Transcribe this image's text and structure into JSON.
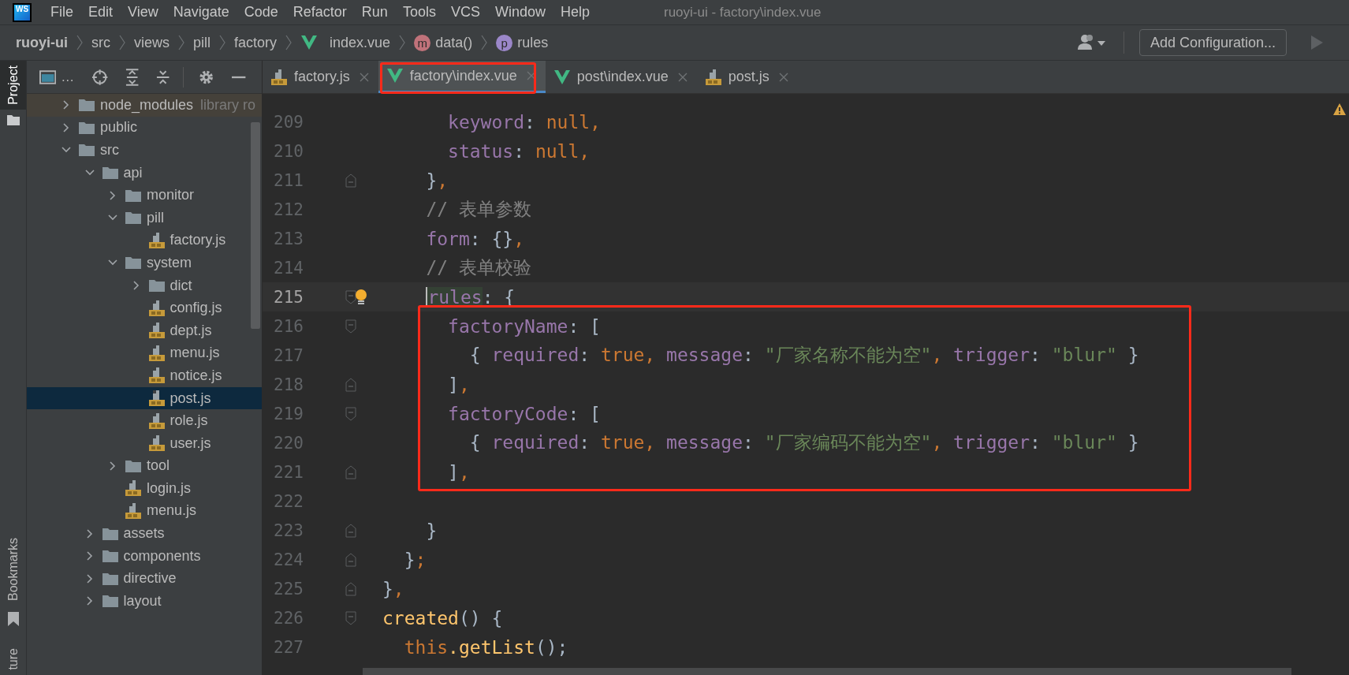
{
  "menu_bar": {
    "logo_text": "WS",
    "items": [
      "File",
      "Edit",
      "View",
      "Navigate",
      "Code",
      "Refactor",
      "Run",
      "Tools",
      "VCS",
      "Window",
      "Help"
    ],
    "title": "ruoyi-ui - factory\\index.vue"
  },
  "breadcrumb": {
    "items": [
      {
        "label": "ruoyi-ui",
        "kind": "project"
      },
      {
        "label": "src",
        "kind": "folder"
      },
      {
        "label": "views",
        "kind": "folder"
      },
      {
        "label": "pill",
        "kind": "folder"
      },
      {
        "label": "factory",
        "kind": "folder"
      },
      {
        "label": "index.vue",
        "kind": "vue"
      },
      {
        "label": "data()",
        "kind": "method",
        "badge": "m"
      },
      {
        "label": "rules",
        "kind": "property",
        "badge": "p"
      }
    ],
    "config_button": "Add Configuration..."
  },
  "tool_strip": {
    "top": [
      {
        "label": "Project",
        "selected": true
      }
    ],
    "bottom": [
      {
        "label": "Bookmarks",
        "selected": false
      },
      {
        "label": "ture",
        "selected": false
      }
    ]
  },
  "project": {
    "title": "…",
    "tree": [
      {
        "name": "node_modules",
        "kind": "folder",
        "expanded": false,
        "selected": false,
        "hint": "library ro"
      },
      {
        "name": "public",
        "kind": "folder",
        "expanded": false,
        "selected": false
      },
      {
        "name": "src",
        "kind": "folder",
        "expanded": true,
        "selected": false,
        "children": [
          {
            "name": "api",
            "kind": "folder",
            "expanded": true,
            "selected": false,
            "children": [
              {
                "name": "monitor",
                "kind": "folder",
                "expanded": false,
                "selected": false
              },
              {
                "name": "pill",
                "kind": "folder",
                "expanded": true,
                "selected": false,
                "children": [
                  {
                    "name": "factory.js",
                    "kind": "js",
                    "selected": false
                  }
                ]
              },
              {
                "name": "system",
                "kind": "folder",
                "expanded": true,
                "selected": false,
                "children": [
                  {
                    "name": "dict",
                    "kind": "folder",
                    "expanded": false,
                    "selected": false
                  },
                  {
                    "name": "config.js",
                    "kind": "js",
                    "selected": false
                  },
                  {
                    "name": "dept.js",
                    "kind": "js",
                    "selected": false
                  },
                  {
                    "name": "menu.js",
                    "kind": "js",
                    "selected": false
                  },
                  {
                    "name": "notice.js",
                    "kind": "js",
                    "selected": false
                  },
                  {
                    "name": "post.js",
                    "kind": "js",
                    "selected": true
                  },
                  {
                    "name": "role.js",
                    "kind": "js",
                    "selected": false
                  },
                  {
                    "name": "user.js",
                    "kind": "js",
                    "selected": false
                  }
                ]
              },
              {
                "name": "tool",
                "kind": "folder",
                "expanded": false,
                "selected": false
              },
              {
                "name": "login.js",
                "kind": "js",
                "selected": false
              },
              {
                "name": "menu.js",
                "kind": "js",
                "selected": false
              }
            ]
          },
          {
            "name": "assets",
            "kind": "folder",
            "expanded": false,
            "selected": false
          },
          {
            "name": "components",
            "kind": "folder",
            "expanded": false,
            "selected": false
          },
          {
            "name": "directive",
            "kind": "folder",
            "expanded": false,
            "selected": false
          },
          {
            "name": "layout",
            "kind": "folder",
            "expanded": false,
            "selected": false
          }
        ]
      }
    ]
  },
  "tabs": [
    {
      "label": "factory.js",
      "kind": "js",
      "selected": false,
      "framed": false
    },
    {
      "label": "factory\\index.vue",
      "kind": "vue",
      "selected": true,
      "framed": true
    },
    {
      "label": "post\\index.vue",
      "kind": "vue",
      "selected": false,
      "framed": false
    },
    {
      "label": "post.js",
      "kind": "js",
      "selected": false,
      "framed": false
    }
  ],
  "editor": {
    "warning": true,
    "blocks": [
      {
        "framed": false,
        "lines": [
          {
            "number": "209",
            "current": false,
            "bulb": false,
            "fold_open": false,
            "fold_close": false,
            "tokens": [
              {
                "text": "      keyword",
                "kind": "prop"
              },
              {
                "text": ": ",
                "kind": "punct"
              },
              {
                "text": "null",
                "kind": "kw"
              },
              {
                "text": ",",
                "kind": "kw"
              }
            ]
          },
          {
            "number": "210",
            "current": false,
            "bulb": false,
            "fold_open": false,
            "fold_close": false,
            "tokens": [
              {
                "text": "      status",
                "kind": "prop"
              },
              {
                "text": ": ",
                "kind": "punct"
              },
              {
                "text": "null",
                "kind": "kw"
              },
              {
                "text": ",",
                "kind": "kw"
              }
            ]
          },
          {
            "number": "211",
            "current": false,
            "bulb": false,
            "fold_open": false,
            "fold_close": true,
            "tokens": [
              {
                "text": "    }",
                "kind": "punct"
              },
              {
                "text": ",",
                "kind": "kw"
              }
            ]
          },
          {
            "number": "212",
            "current": false,
            "bulb": false,
            "fold_open": false,
            "fold_close": false,
            "tokens": [
              {
                "text": "    // 表单参数",
                "kind": "comment"
              }
            ]
          },
          {
            "number": "213",
            "current": false,
            "bulb": false,
            "fold_open": false,
            "fold_close": false,
            "tokens": [
              {
                "text": "    form",
                "kind": "prop"
              },
              {
                "text": ": {}",
                "kind": "punct"
              },
              {
                "text": ",",
                "kind": "kw"
              }
            ]
          },
          {
            "number": "214",
            "current": false,
            "bulb": false,
            "fold_open": false,
            "fold_close": false,
            "tokens": [
              {
                "text": "    // 表单校验",
                "kind": "comment"
              }
            ]
          },
          {
            "number": "215",
            "current": true,
            "bulb": true,
            "fold_open": true,
            "fold_close": false,
            "tokens": [
              {
                "text": "    rules",
                "kind": "prop",
                "match": true
              },
              {
                "text": ": {",
                "kind": "punct"
              }
            ]
          }
        ]
      },
      {
        "framed": true,
        "lines": [
          {
            "number": "216",
            "current": false,
            "bulb": false,
            "fold_open": true,
            "fold_close": false,
            "tokens": [
              {
                "text": "      factoryName",
                "kind": "prop"
              },
              {
                "text": ": [",
                "kind": "punct"
              }
            ]
          },
          {
            "number": "217",
            "current": false,
            "bulb": false,
            "fold_open": false,
            "fold_close": false,
            "tokens": [
              {
                "text": "        { ",
                "kind": "punct"
              },
              {
                "text": "required",
                "kind": "prop"
              },
              {
                "text": ": ",
                "kind": "punct"
              },
              {
                "text": "true",
                "kind": "kw"
              },
              {
                "text": ", ",
                "kind": "kw"
              },
              {
                "text": "message",
                "kind": "prop"
              },
              {
                "text": ": ",
                "kind": "punct"
              },
              {
                "text": "\"厂家名称不能为空\"",
                "kind": "str"
              },
              {
                "text": ", ",
                "kind": "kw"
              },
              {
                "text": "trigger",
                "kind": "prop"
              },
              {
                "text": ": ",
                "kind": "punct"
              },
              {
                "text": "\"blur\"",
                "kind": "str"
              },
              {
                "text": " }",
                "kind": "punct"
              }
            ]
          },
          {
            "number": "218",
            "current": false,
            "bulb": false,
            "fold_open": false,
            "fold_close": true,
            "tokens": [
              {
                "text": "      ]",
                "kind": "punct"
              },
              {
                "text": ",",
                "kind": "kw"
              }
            ]
          },
          {
            "number": "219",
            "current": false,
            "bulb": false,
            "fold_open": true,
            "fold_close": false,
            "tokens": [
              {
                "text": "      factoryCode",
                "kind": "prop"
              },
              {
                "text": ": [",
                "kind": "punct"
              }
            ]
          },
          {
            "number": "220",
            "current": false,
            "bulb": false,
            "fold_open": false,
            "fold_close": false,
            "tokens": [
              {
                "text": "        { ",
                "kind": "punct"
              },
              {
                "text": "required",
                "kind": "prop"
              },
              {
                "text": ": ",
                "kind": "punct"
              },
              {
                "text": "true",
                "kind": "kw"
              },
              {
                "text": ", ",
                "kind": "kw"
              },
              {
                "text": "message",
                "kind": "prop"
              },
              {
                "text": ": ",
                "kind": "punct"
              },
              {
                "text": "\"厂家编码不能为空\"",
                "kind": "str"
              },
              {
                "text": ", ",
                "kind": "kw"
              },
              {
                "text": "trigger",
                "kind": "prop"
              },
              {
                "text": ": ",
                "kind": "punct"
              },
              {
                "text": "\"blur\"",
                "kind": "str"
              },
              {
                "text": " }",
                "kind": "punct"
              }
            ]
          },
          {
            "number": "221",
            "current": false,
            "bulb": false,
            "fold_open": false,
            "fold_close": true,
            "tokens": [
              {
                "text": "      ]",
                "kind": "punct"
              },
              {
                "text": ",",
                "kind": "kw"
              }
            ]
          }
        ]
      },
      {
        "framed": false,
        "lines": [
          {
            "number": "222",
            "current": false,
            "bulb": false,
            "fold_open": false,
            "fold_close": false
          },
          {
            "number": "223",
            "current": false,
            "bulb": false,
            "fold_open": false,
            "fold_close": true,
            "tokens": [
              {
                "text": "    }",
                "kind": "punct"
              }
            ]
          },
          {
            "number": "224",
            "current": false,
            "bulb": false,
            "fold_open": false,
            "fold_close": true,
            "tokens": [
              {
                "text": "  }",
                "kind": "punct"
              },
              {
                "text": ";",
                "kind": "kw"
              }
            ]
          },
          {
            "number": "225",
            "current": false,
            "bulb": false,
            "fold_open": false,
            "fold_close": true,
            "tokens": [
              {
                "text": "}",
                "kind": "punct"
              },
              {
                "text": ",",
                "kind": "kw"
              }
            ]
          },
          {
            "number": "226",
            "current": false,
            "bulb": false,
            "fold_open": true,
            "fold_close": false,
            "tokens": [
              {
                "text": "created",
                "kind": "fn"
              },
              {
                "text": "() {",
                "kind": "punct"
              }
            ]
          },
          {
            "number": "227",
            "current": false,
            "bulb": false,
            "fold_open": false,
            "fold_close": false,
            "tokens": [
              {
                "text": "  this",
                "kind": "kw"
              },
              {
                "text": ".getList",
                "kind": "fn"
              },
              {
                "text": "();",
                "kind": "punct"
              }
            ]
          }
        ]
      }
    ]
  }
}
